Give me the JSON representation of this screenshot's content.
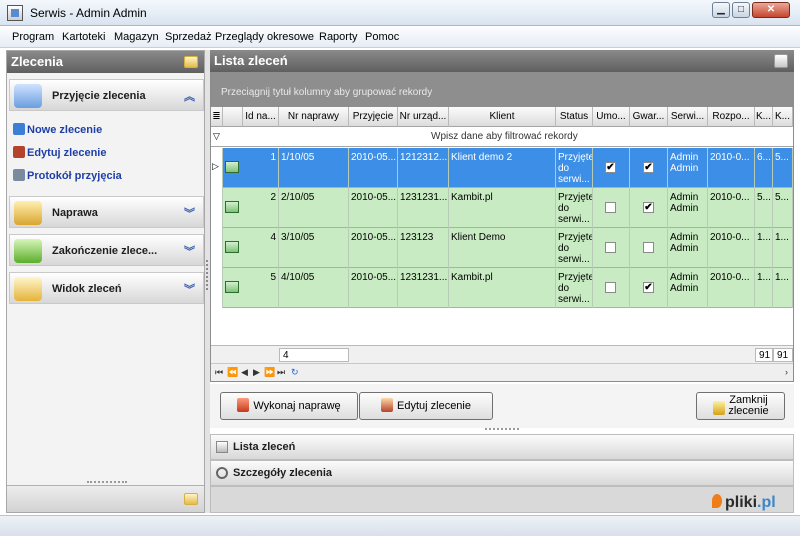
{
  "window": {
    "title": "Serwis -  Admin Admin"
  },
  "menu": [
    "Program",
    "Kartoteki",
    "Magazyn",
    "Sprzedaż",
    "Przeglądy okresowe",
    "Raporty",
    "Pomoc"
  ],
  "left": {
    "title": "Zlecenia",
    "groups": [
      {
        "label": "Przyjęcie zlecenia",
        "icon": "wrench-icon",
        "expanded": true
      },
      {
        "label": "Naprawa",
        "icon": "wrench-icon",
        "expanded": false
      },
      {
        "label": "Zakończenie zlece...",
        "icon": "person-icon",
        "expanded": false
      },
      {
        "label": "Widok zleceń",
        "icon": "magnifier-icon",
        "expanded": false
      }
    ],
    "tasks": [
      {
        "label": "Nowe zlecenie",
        "icon": "new-order-icon"
      },
      {
        "label": "Edytuj zlecenie",
        "icon": "edit-order-icon"
      },
      {
        "label": "Protokół przyjęcia",
        "icon": "printer-icon"
      }
    ]
  },
  "main": {
    "title": "Lista zleceń",
    "group_hint": "Przeciągnij tytuł kolumny aby grupować rekordy",
    "filter_hint": "Wpisz dane aby filtrować rekordy",
    "columns": [
      "Id na...",
      "Nr naprawy",
      "Przyjęcie",
      "Nr urząd...",
      "Klient",
      "Status",
      "Umo...",
      "Gwar...",
      "Serwi...",
      "Rozpo...",
      "K...",
      "K..."
    ],
    "rows": [
      {
        "id": "1",
        "nr": "1/10/05",
        "date": "2010-05...",
        "dev": "1212312...",
        "client": "Klient demo 2",
        "status": "Przyjęte do serwi...",
        "umowa": true,
        "gwar": true,
        "serw": "Admin Admin",
        "rozp": "2010-0...",
        "k1": "6...",
        "k2": "5...",
        "selected": true
      },
      {
        "id": "2",
        "nr": "2/10/05",
        "date": "2010-05...",
        "dev": "1231231...",
        "client": "Kambit.pl",
        "status": "Przyjęte do serwi...",
        "umowa": false,
        "gwar": true,
        "serw": "Admin Admin",
        "rozp": "2010-0...",
        "k1": "5...",
        "k2": "5...",
        "selected": false
      },
      {
        "id": "4",
        "nr": "3/10/05",
        "date": "2010-05...",
        "dev": "123123",
        "client": "Klient Demo",
        "status": "Przyjęte do serwi...",
        "umowa": false,
        "gwar": false,
        "serw": "Admin Admin",
        "rozp": "2010-0...",
        "k1": "1...",
        "k2": "1...",
        "selected": false
      },
      {
        "id": "5",
        "nr": "4/10/05",
        "date": "2010-05...",
        "dev": "1231231...",
        "client": "Kambit.pl",
        "status": "Przyjęte do serwi...",
        "umowa": false,
        "gwar": true,
        "serw": "Admin Admin",
        "rozp": "2010-0...",
        "k1": "1...",
        "k2": "1...",
        "selected": false
      }
    ],
    "summary": {
      "count": "4",
      "k1": "91",
      "k2": "91"
    },
    "buttons": {
      "repair": "Wykonaj naprawę",
      "edit": "Edytuj zlecenie",
      "close_line1": "Zamknij",
      "close_line2": "zlecenie"
    },
    "panes": [
      "Lista zleceń",
      "Szczegóły zlecenia"
    ]
  },
  "watermark": {
    "brand": "pliki",
    "tld": ".pl"
  },
  "colors": {
    "row_green": "#c9ebc3",
    "row_selected": "#3d8ee6",
    "header_gray": "#7a7a7a"
  }
}
